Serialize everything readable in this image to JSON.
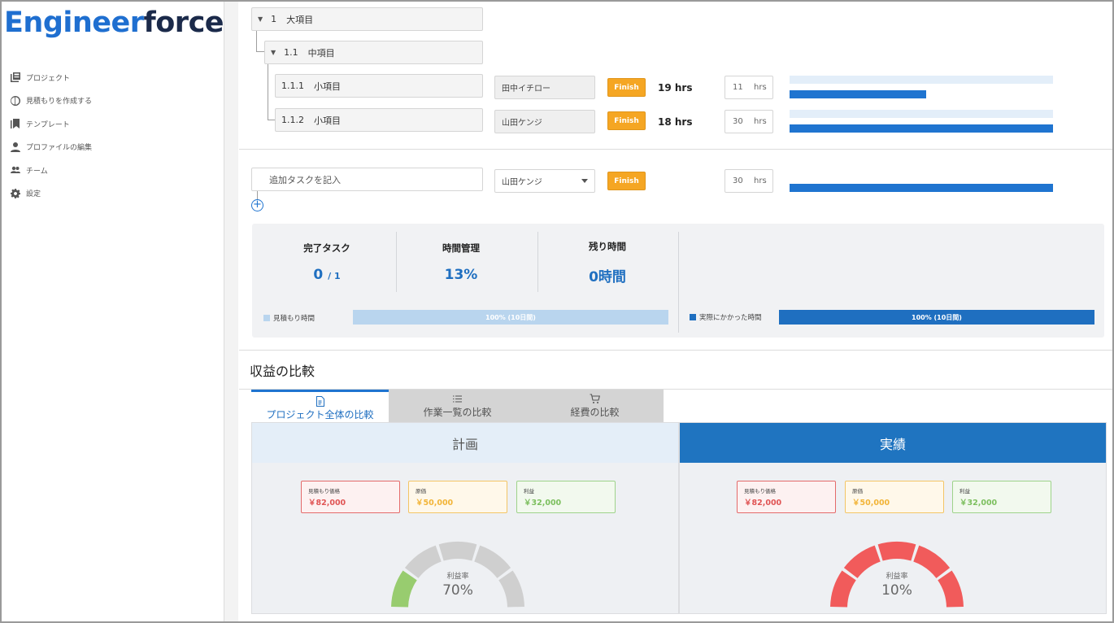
{
  "app": {
    "logo_part1": "Engineer",
    "logo_part2": "force"
  },
  "sidebar": {
    "items": [
      {
        "label": "プロジェクト",
        "icon": "projects-icon"
      },
      {
        "label": "見積もりを作成する",
        "icon": "estimate-icon"
      },
      {
        "label": "テンプレート",
        "icon": "template-icon"
      },
      {
        "label": "プロファイルの編集",
        "icon": "person-icon"
      },
      {
        "label": "チーム",
        "icon": "team-icon"
      },
      {
        "label": "設定",
        "icon": "gear-icon"
      }
    ]
  },
  "tree": {
    "level1": {
      "number": "1",
      "title": "大項目"
    },
    "level2": {
      "number": "1.1",
      "title": "中項目"
    },
    "tasks": [
      {
        "number": "1.1.1",
        "title": "小項目",
        "assignee": "田中イチロー",
        "finish_label": "Finish",
        "actual_hours": "19 hrs",
        "estimate_hours": "11",
        "hrs_unit": "hrs",
        "progress": 0.52
      },
      {
        "number": "1.1.2",
        "title": "小項目",
        "assignee": "山田ケンジ",
        "finish_label": "Finish",
        "actual_hours": "18 hrs",
        "estimate_hours": "30",
        "hrs_unit": "hrs",
        "progress": 1.0
      }
    ]
  },
  "new_task": {
    "placeholder": "追加タスクを記入",
    "assignee": "山田ケンジ",
    "finish_label": "Finish",
    "estimate_hours": "30",
    "hrs_unit": "hrs",
    "progress": 1.0
  },
  "stats": {
    "completed": {
      "label": "完了タスク",
      "value": "0",
      "total": "/ 1"
    },
    "time": {
      "label": "時間管理",
      "value": "13%"
    },
    "remaining": {
      "label": "残り時間",
      "value": "0時間"
    },
    "estimate_legend": "見積もり時間",
    "estimate_bar": "100% (10日間)",
    "actual_legend": "実際にかかった時間",
    "actual_bar": "100% (10日間)",
    "colors": {
      "estimate": "#b9d5ee",
      "actual": "#1f6fc0"
    }
  },
  "revenue": {
    "title": "収益の比較",
    "tabs": [
      {
        "label": "プロジェクト全体の比較",
        "icon": "document-icon",
        "active": true
      },
      {
        "label": "作業一覧の比較",
        "icon": "list-icon",
        "active": false
      },
      {
        "label": "経費の比較",
        "icon": "cart-icon",
        "active": false
      }
    ],
    "plan": {
      "title": "計画",
      "estimate_price_label": "見積もり価格",
      "estimate_price": "￥82,000",
      "cost_label": "原価",
      "cost": "￥50,000",
      "profit_label": "利益",
      "profit": "￥32,000",
      "rate_label": "利益率",
      "rate": "70%",
      "rate_value": 0.7,
      "gauge_color": "#98cc6f"
    },
    "actual": {
      "title": "実績",
      "estimate_price_label": "見積もり価格",
      "estimate_price": "￥82,000",
      "cost_label": "原価",
      "cost": "￥50,000",
      "profit_label": "利益",
      "profit": "￥32,000",
      "rate_label": "利益率",
      "rate": "10%",
      "rate_value": 0.1,
      "gauge_color": "#f15b5b"
    }
  }
}
